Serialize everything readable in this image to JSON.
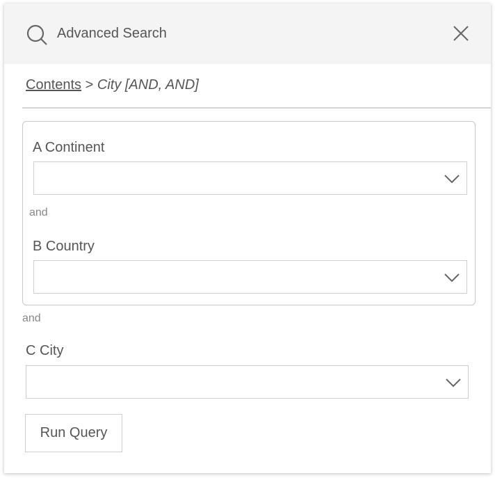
{
  "header": {
    "title": "Advanced Search"
  },
  "breadcrumb": {
    "root": "Contents",
    "separator": ">",
    "current": "City [AND, AND]"
  },
  "group": {
    "field_a": {
      "label": "A Continent",
      "value": ""
    },
    "connector": "and",
    "field_b": {
      "label": "B Country",
      "value": ""
    }
  },
  "outer_connector": "and",
  "field_c": {
    "label": "C City",
    "value": ""
  },
  "run_button": "Run Query"
}
